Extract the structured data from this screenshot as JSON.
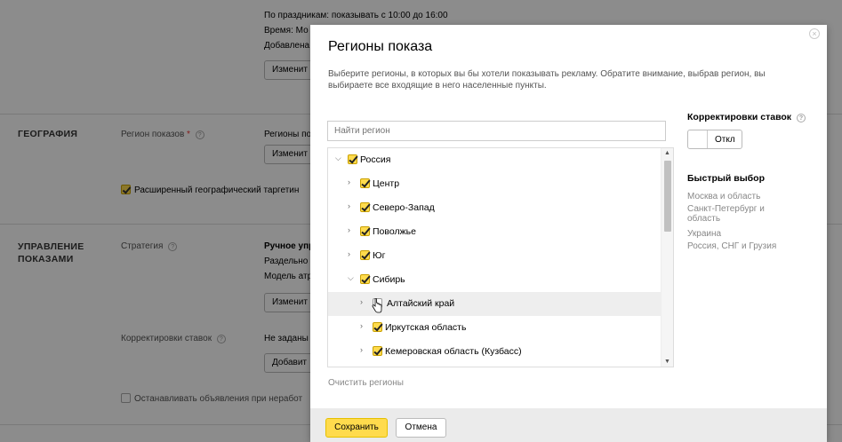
{
  "background": {
    "holiday_line": "По праздникам: показывать с 10:00 до 16:00",
    "time_line": "Время: Мо",
    "added_line": "Добавлена",
    "change_btn_1": "Изменит",
    "geo_section": "ГЕОГРАФИЯ",
    "region_label": "Регион показов",
    "required_mark": "*",
    "regions_value": "Регионы по",
    "change_btn_2": "Изменит",
    "ext_geo": "Расширенный географический таргетин",
    "mgmt_section_1": "УПРАВЛЕНИЕ",
    "mgmt_section_2": "ПОКАЗАМИ",
    "strategy_label": "Стратегия",
    "strategy_value_1": "Ручное упр",
    "strategy_value_2": "Раздельно",
    "strategy_value_3": "Модель атр",
    "change_btn_3": "Изменит",
    "bid_adj_label": "Корректировки ставок",
    "bid_adj_value": "Не заданы",
    "add_btn": "Добавит",
    "stop_ads": "Останавливать объявления при неработ"
  },
  "modal": {
    "title": "Регионы показа",
    "description": "Выберите регионы, в которых вы бы хотели показывать рекламу. Обратите внимание, выбрав регион, вы выбираете все входящие в него населенные пункты.",
    "search_placeholder": "Найти регион",
    "tree": [
      {
        "label": "Россия",
        "level": 0,
        "expanded": true,
        "checked": true
      },
      {
        "label": "Центр",
        "level": 1,
        "expanded": false,
        "checked": true
      },
      {
        "label": "Северо-Запад",
        "level": 1,
        "expanded": false,
        "checked": true
      },
      {
        "label": "Поволжье",
        "level": 1,
        "expanded": false,
        "checked": true
      },
      {
        "label": "Юг",
        "level": 1,
        "expanded": false,
        "checked": true
      },
      {
        "label": "Сибирь",
        "level": 1,
        "expanded": true,
        "checked": true
      },
      {
        "label": "Алтайский край",
        "level": 2,
        "expanded": false,
        "checked": false
      },
      {
        "label": "Иркутская область",
        "level": 2,
        "expanded": false,
        "checked": true
      },
      {
        "label": "Кемеровская область (Кузбасс)",
        "level": 2,
        "expanded": false,
        "checked": true
      }
    ],
    "clear_regions": "Очистить регионы",
    "bid_adjustments_title": "Корректировки ставок",
    "toggle_label": "Откл",
    "quick_select_title": "Быстрый выбор",
    "quick_select": [
      "Москва и область",
      "Санкт-Петербург и область",
      "Украина",
      "Россия, СНГ и Грузия"
    ],
    "save_label": "Сохранить",
    "cancel_label": "Отмена"
  },
  "colors": {
    "accent": "#ffdb4d",
    "overlay": "#000000"
  },
  "icons": {
    "close": "close-icon",
    "help": "help-icon",
    "expand": "chevron-right-icon",
    "collapse": "chevron-down-icon"
  }
}
